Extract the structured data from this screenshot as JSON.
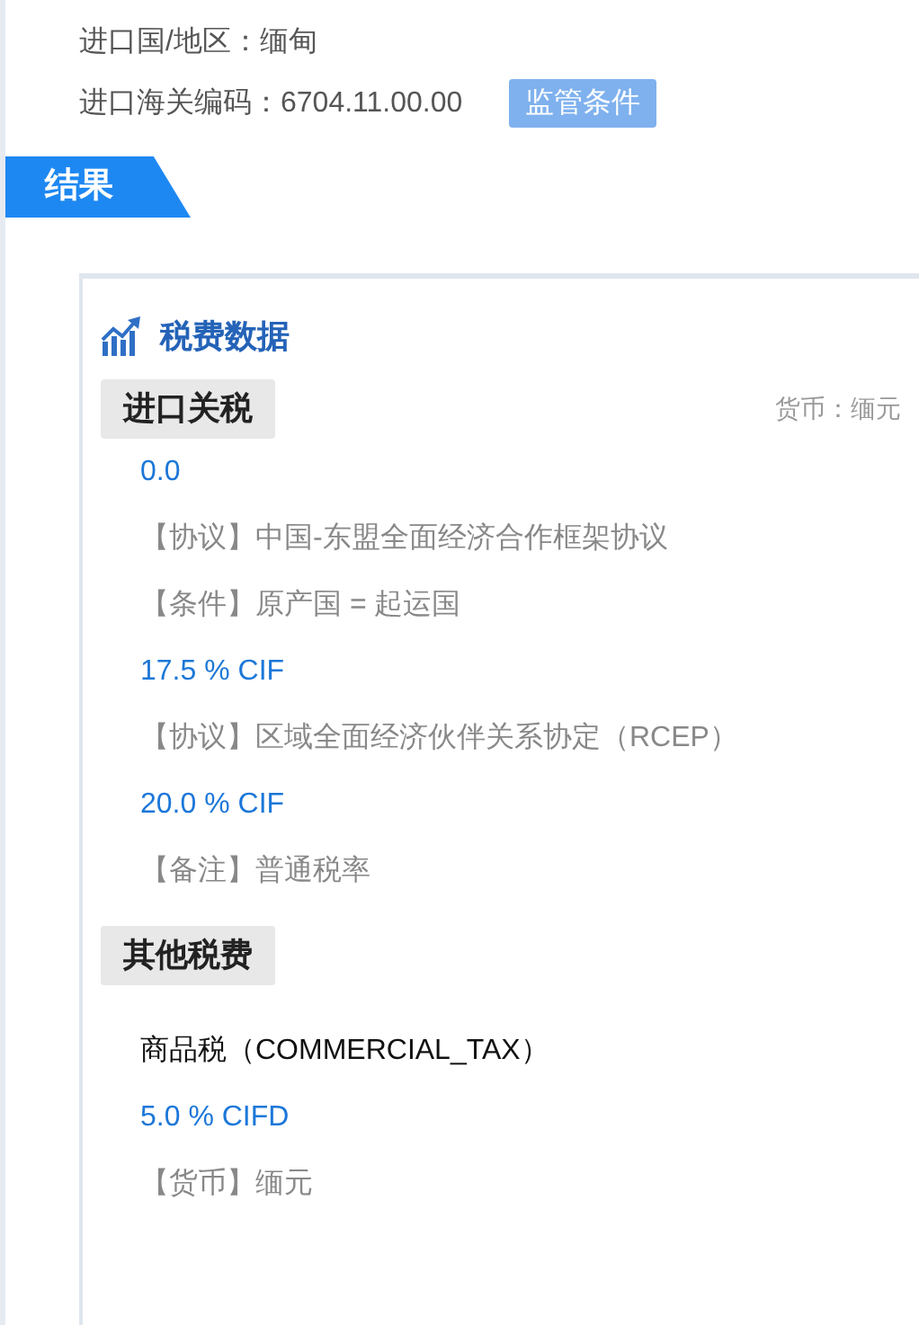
{
  "info": [
    {
      "label": "进口国/地区：缅甸"
    },
    {
      "label": "进口海关编码：6704.11.00.00",
      "tag": "监管条件"
    }
  ],
  "result_tab": "结果",
  "card": {
    "title": "税费数据",
    "sections": [
      {
        "heading": "进口关税",
        "note": "货币：缅元",
        "lines": [
          {
            "kind": "rate",
            "text": "0.0"
          },
          {
            "kind": "detail",
            "text": "【协议】中国-东盟全面经济合作框架协议"
          },
          {
            "kind": "detail",
            "text": "【条件】原产国 = 起运国"
          },
          {
            "kind": "rate",
            "text": "17.5 % CIF"
          },
          {
            "kind": "detail",
            "text": "【协议】区域全面经济伙伴关系协定（RCEP）"
          },
          {
            "kind": "rate",
            "text": "20.0 % CIF"
          },
          {
            "kind": "detail",
            "text": "【备注】普通税率"
          }
        ]
      },
      {
        "heading": "其他税费",
        "lines": [
          {
            "kind": "name",
            "text": "商品税（COMMERCIAL_TAX）"
          },
          {
            "kind": "rate",
            "text": "5.0 % CIFD"
          },
          {
            "kind": "detail",
            "text": "【货币】缅元"
          }
        ]
      }
    ]
  }
}
